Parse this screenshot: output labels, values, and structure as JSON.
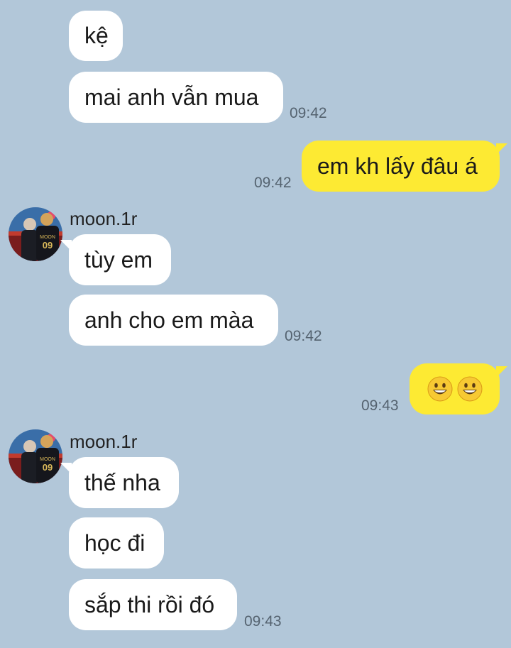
{
  "messages": [
    {
      "text": "kệ"
    },
    {
      "text": "mai anh vẫn mua",
      "time": "09:42"
    },
    {
      "text": "em kh lấy đâu á",
      "time": "09:42"
    },
    {
      "text": "tùy em"
    },
    {
      "text": "anh cho em màa",
      "time": "09:42"
    },
    {
      "emoji": [
        "grinning-face-emoji",
        "grinning-face-emoji"
      ],
      "time": "09:43"
    },
    {
      "text": "thế nha"
    },
    {
      "text": "học đi"
    },
    {
      "text": "sắp thi rồi đó",
      "time": "09:43"
    }
  ],
  "senders": [
    "moon.1r",
    "moon.1r"
  ],
  "colors": {
    "background": "#b2c7d9",
    "incoming_bubble": "#ffffff",
    "outgoing_bubble": "#fdea33",
    "timestamp": "#556370"
  }
}
